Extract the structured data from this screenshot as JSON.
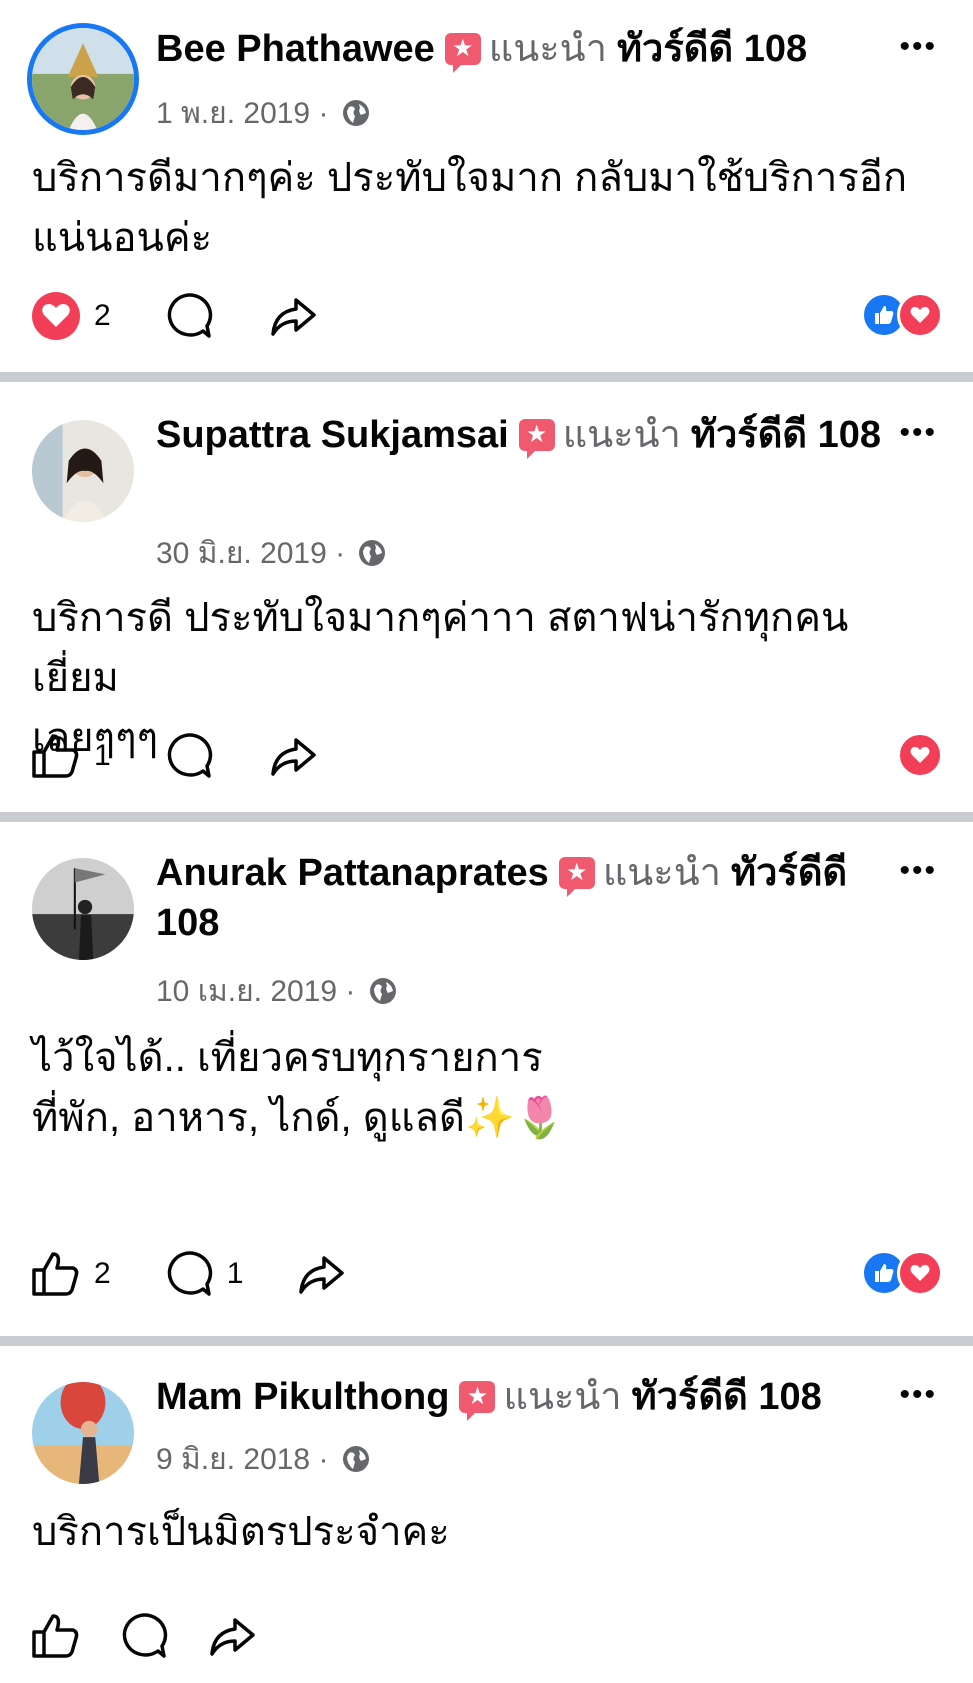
{
  "posts": [
    {
      "name": "Bee Phathawee",
      "recommend_label": "แนะนำ",
      "page_name": "ทัวร์ดีดี 108",
      "date": "1 พ.ย. 2019 ·",
      "text": "บริการดีมากๆค่ะ ประทับใจมาก กลับมาใช้บริการอีก\nแน่นอนค่ะ",
      "reaction_count": "2",
      "comment_count": "",
      "reaction_icons": [
        "like",
        "love"
      ]
    },
    {
      "name": "Supattra Sukjamsai",
      "recommend_label": "แนะนำ",
      "page_name": "ทัวร์ดีดี 108",
      "date": "30 มิ.ย. 2019 ·",
      "text": "บริการดี ประทับใจมากๆค่าาา สตาฟน่ารักทุกคน เยี่ยม\nเลยๆๆๆ",
      "reaction_count": "1",
      "comment_count": "",
      "reaction_icons": [
        "love"
      ]
    },
    {
      "name": "Anurak Pattanaprates",
      "recommend_label": "แนะนำ",
      "page_name": "ทัวร์ดีดี 108",
      "date": "10 เม.ย. 2019 ·",
      "text": "ไว้ใจได้.. เที่ยวครบทุกรายการ\nที่พัก, อาหาร, ไกด์, ดูแลดี✨🌷",
      "reaction_count": "2",
      "comment_count": "1",
      "reaction_icons": [
        "like",
        "love"
      ]
    },
    {
      "name": "Mam Pikulthong",
      "recommend_label": "แนะนำ",
      "page_name": "ทัวร์ดีดี 108",
      "date": "9 มิ.ย. 2018 ·",
      "text": "บริการเป็นมิตรประจำคะ",
      "reaction_count": "",
      "comment_count": "",
      "reaction_icons": []
    }
  ],
  "badge_glyph": "★",
  "more_glyph": "•••",
  "colors": {
    "accent": "#1877f2",
    "love": "#f33e58",
    "badge": "#f05a6e",
    "muted": "#65676b",
    "separator": "#c9ccd1"
  }
}
